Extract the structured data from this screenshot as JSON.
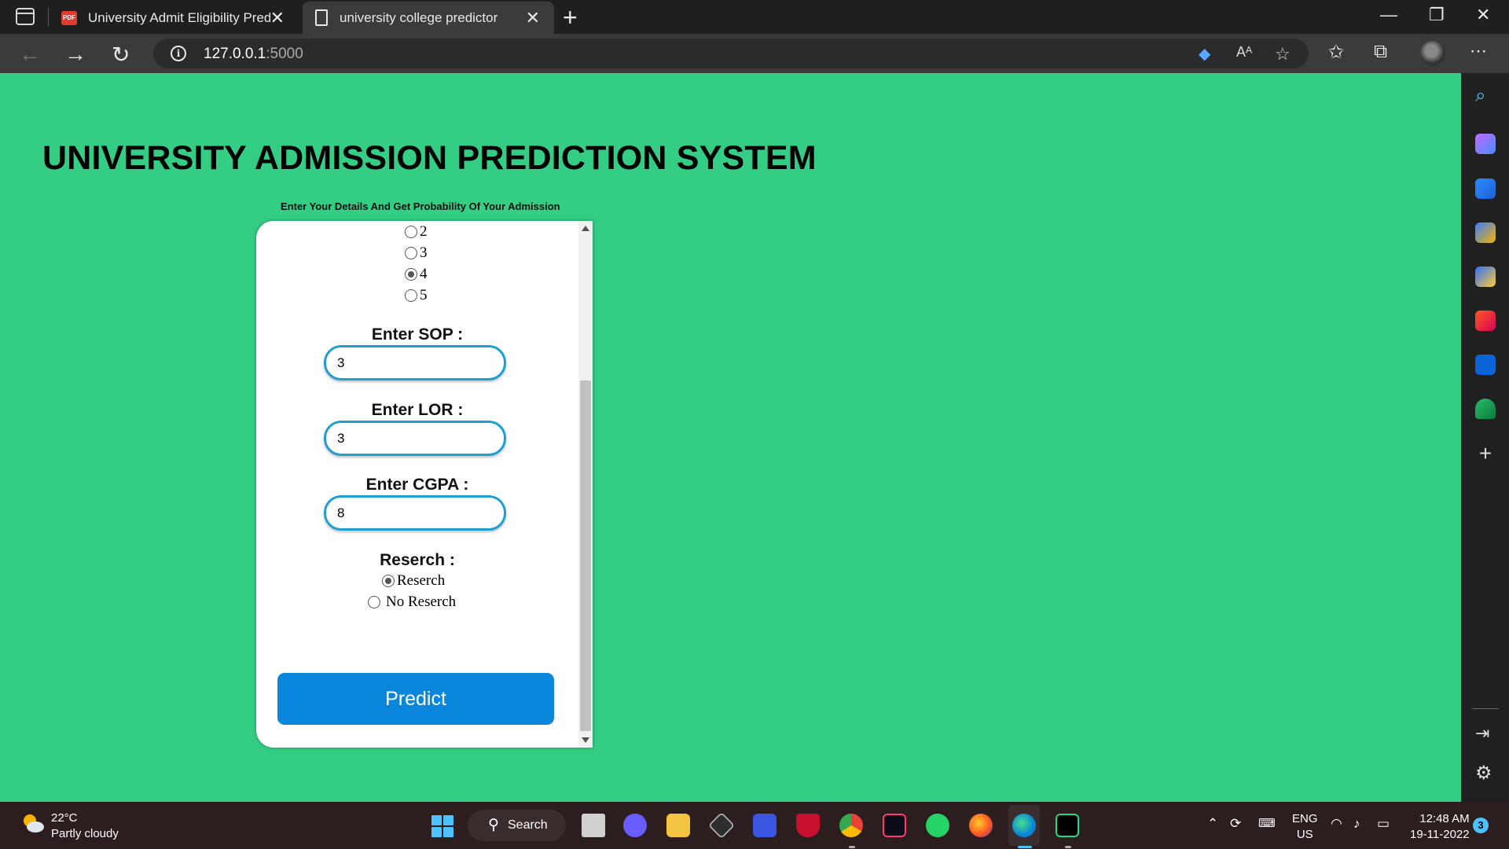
{
  "browser": {
    "tabs": [
      {
        "title": "University Admit Eligibility Prediction",
        "favicon": "pdf-icon",
        "active": false
      },
      {
        "title": "university college predictor",
        "favicon": "document-icon",
        "active": true
      }
    ],
    "url_host": "127.0.0.1",
    "url_port": ":5000"
  },
  "page": {
    "title": "UNIVERSITY ADMISSION PREDICTION SYSTEM",
    "subtitle": "Enter Your Details And Get Probability Of Your Admission"
  },
  "form": {
    "rating_options": [
      {
        "label": "2",
        "checked": false
      },
      {
        "label": "3",
        "checked": false
      },
      {
        "label": "4",
        "checked": true
      },
      {
        "label": "5",
        "checked": false
      }
    ],
    "sop_label": "Enter SOP :",
    "sop_value": "3",
    "lor_label": "Enter LOR :",
    "lor_value": "3",
    "cgpa_label": "Enter CGPA :",
    "cgpa_value": "8",
    "research_label": "Reserch :",
    "research_options": [
      {
        "label": "Reserch",
        "checked": true
      },
      {
        "label": "No Reserch",
        "checked": false
      }
    ],
    "predict_label": "Predict"
  },
  "taskbar": {
    "weather_temp": "22°C",
    "weather_desc": "Partly cloudy",
    "search_label": "Search",
    "lang_top": "ENG",
    "lang_bottom": "US",
    "time": "12:48 AM",
    "date": "19-11-2022",
    "notification_count": "3"
  },
  "colors": {
    "page_background": "#34cd84",
    "predict_button": "#0a86dd",
    "input_border": "#1f9fd2"
  }
}
